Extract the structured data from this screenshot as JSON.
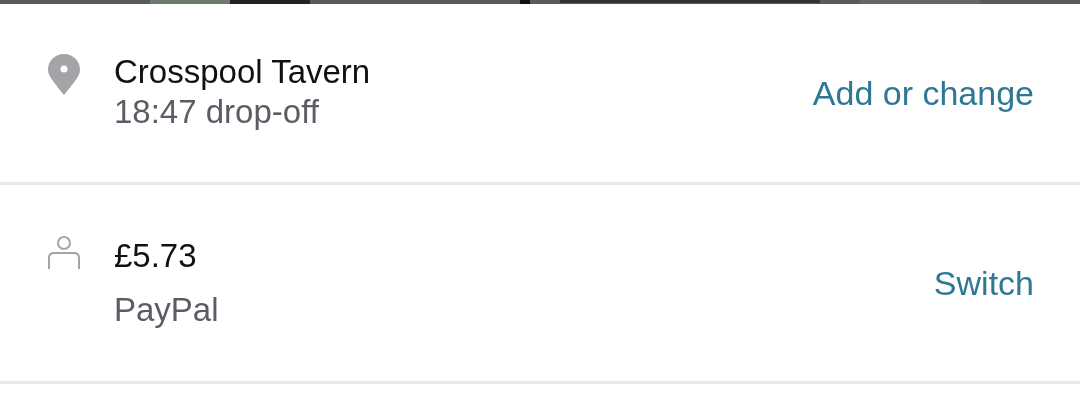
{
  "rows": [
    {
      "kind": "location",
      "title": "Crosspool Tavern",
      "subtitle": "18:47 drop-off",
      "action": "Add or change"
    },
    {
      "kind": "payment",
      "title": "£5.73",
      "subtitle": "PayPal",
      "action": "Switch"
    }
  ]
}
